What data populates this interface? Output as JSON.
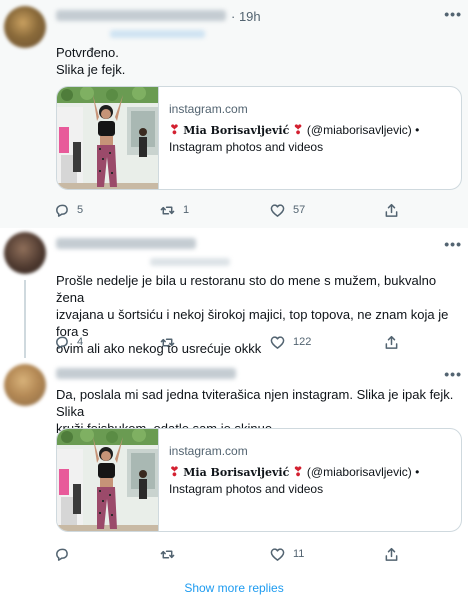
{
  "tweets": [
    {
      "time": "· 19h",
      "text_lines": [
        "Potvrđeno.",
        "Slika je fejk."
      ],
      "card": {
        "domain": "instagram.com",
        "title_name": "Mia Borisavljević",
        "title_handle": "(@miaborisavljevic) •",
        "title_heart": "❣",
        "description": "Instagram photos and videos"
      },
      "actions": {
        "reply": "5",
        "retweet": "1",
        "like": "57"
      }
    },
    {
      "text_lines": [
        "Prošle nedelje je bila u restoranu sto do mene s mužem, bukvalno žena",
        "izvajana u šortsiću i nekoj širokoj majici, top topova, ne znam koja je fora s",
        "ovim ali ako nekog to usrećuje okkk"
      ],
      "actions": {
        "reply": "4",
        "retweet": "",
        "like": "122"
      }
    },
    {
      "text_lines": [
        "Da, poslala mi sad jedna tviterašica njen instagram. Slika je ipak fejk. Slika",
        "kruži fejsbukom, odatle sam je skinuo"
      ],
      "card": {
        "domain": "instagram.com",
        "title_name": "Mia Borisavljević",
        "title_handle": "(@miaborisavljevic) •",
        "title_heart": "❣",
        "description": "Instagram photos and videos"
      },
      "actions": {
        "reply": "",
        "retweet": "",
        "like": "11"
      }
    }
  ],
  "show_more": "Show more replies",
  "icons": [
    "reply-icon",
    "retweet-icon",
    "like-icon",
    "share-icon",
    "more-icon"
  ],
  "colors": {
    "link": "#1d9bf0",
    "muted": "#536471",
    "heart": "#d32030",
    "border": "#cfd9de"
  }
}
